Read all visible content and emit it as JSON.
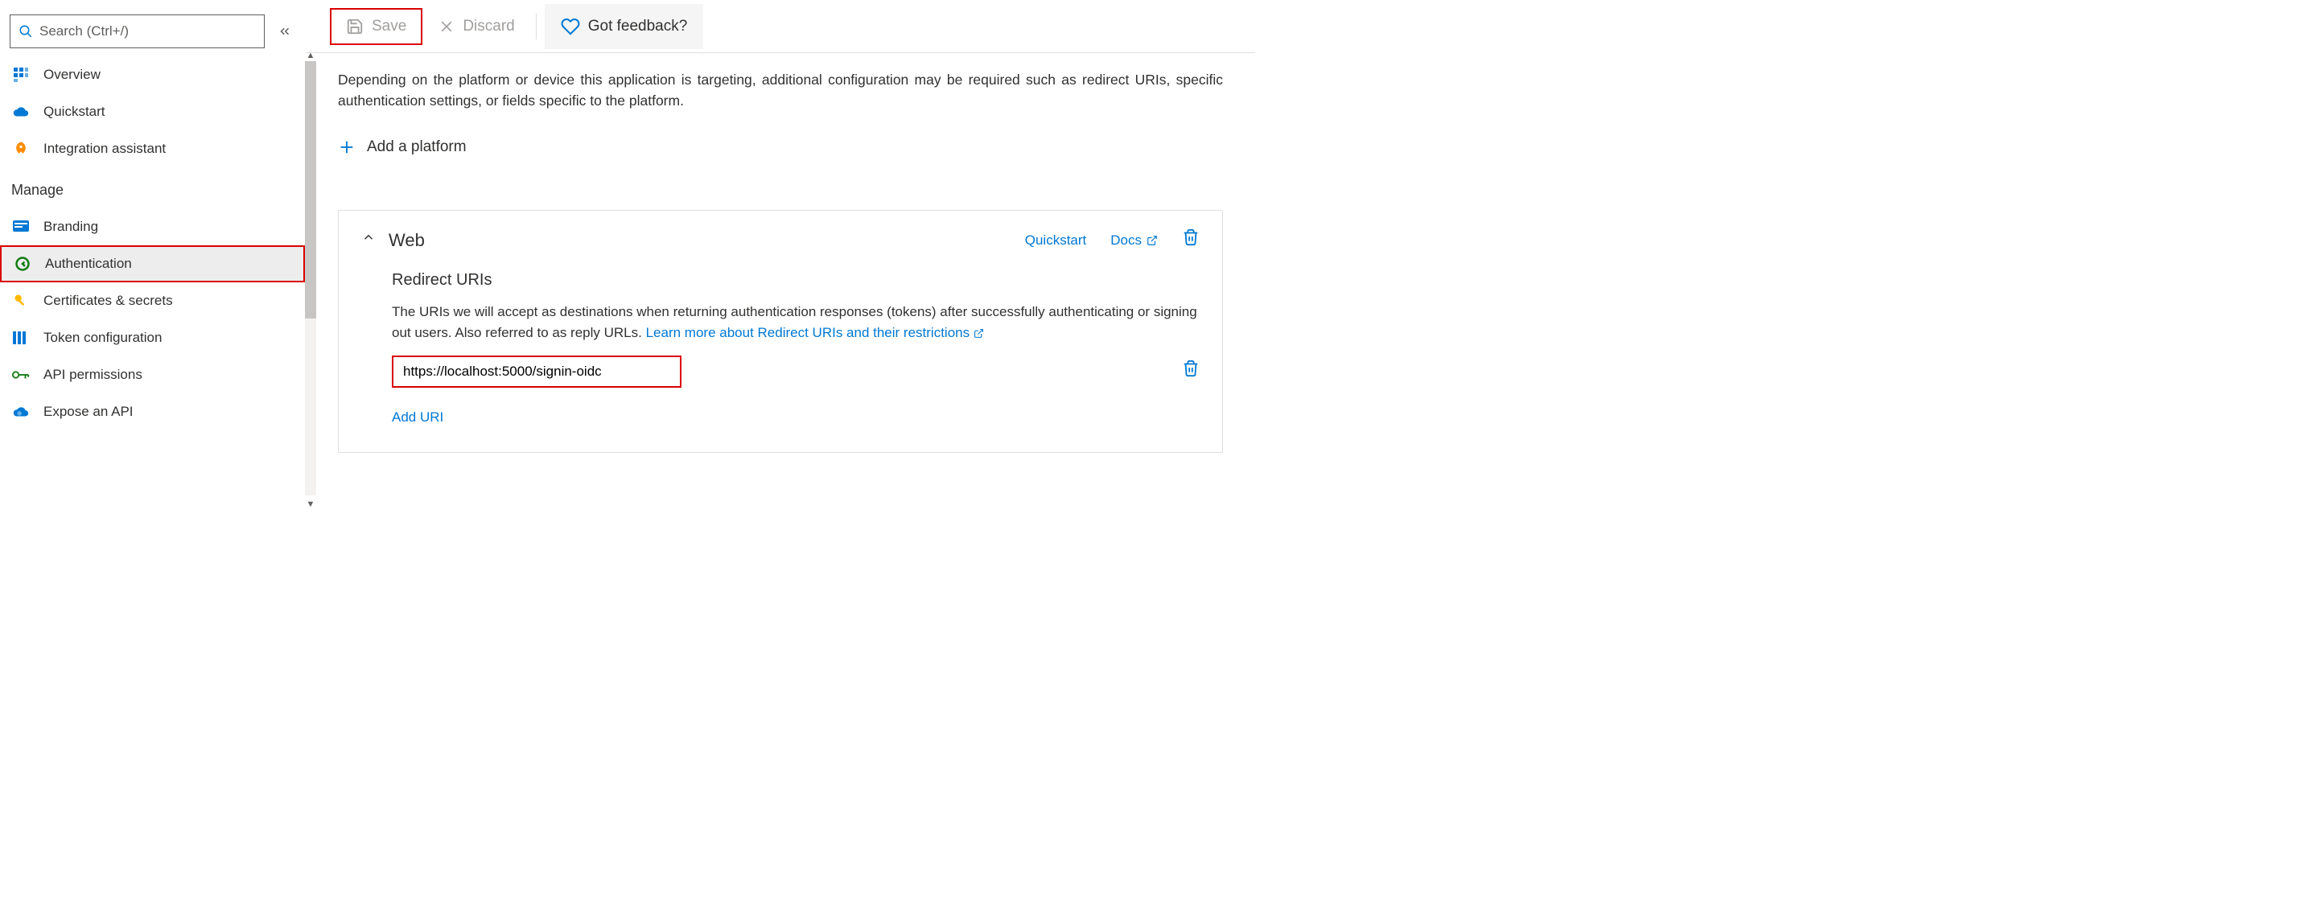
{
  "search": {
    "placeholder": "Search (Ctrl+/)"
  },
  "sidebar": {
    "items": [
      {
        "label": "Overview"
      },
      {
        "label": "Quickstart"
      },
      {
        "label": "Integration assistant"
      }
    ],
    "manage_header": "Manage",
    "manage_items": [
      {
        "label": "Branding"
      },
      {
        "label": "Authentication"
      },
      {
        "label": "Certificates & secrets"
      },
      {
        "label": "Token configuration"
      },
      {
        "label": "API permissions"
      },
      {
        "label": "Expose an API"
      }
    ]
  },
  "toolbar": {
    "save": "Save",
    "discard": "Discard",
    "feedback": "Got feedback?"
  },
  "content": {
    "intro": "Depending on the platform or device this application is targeting, additional configuration may be required such as redirect URIs, specific authentication settings, or fields specific to the platform.",
    "add_platform": "Add a platform"
  },
  "card": {
    "title": "Web",
    "quickstart": "Quickstart",
    "docs": "Docs",
    "sub_title": "Redirect URIs",
    "desc_prefix": "The URIs we will accept as destinations when returning authentication responses (tokens) after successfully authenticating or signing out users. Also referred to as reply URLs. ",
    "desc_link": "Learn more about Redirect URIs and their restrictions",
    "uri_value": "https://localhost:5000/signin-oidc",
    "add_uri": "Add URI"
  }
}
